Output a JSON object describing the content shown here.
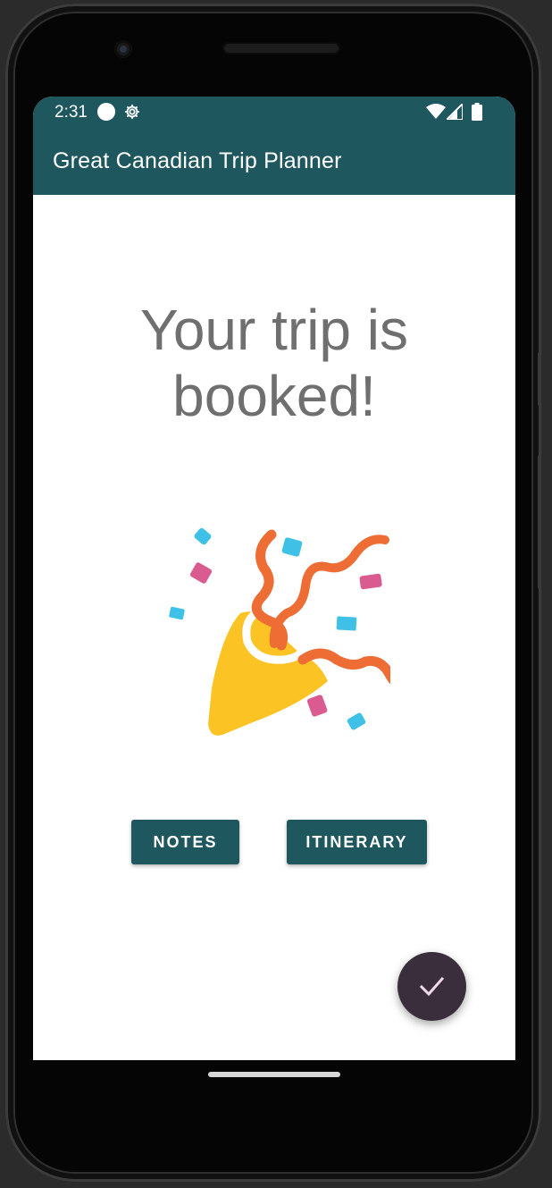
{
  "status_bar": {
    "time": "2:31",
    "icons": [
      "circle-icon",
      "gear-icon",
      "wifi-icon",
      "signal-icon",
      "battery-icon"
    ]
  },
  "app_bar": {
    "title": "Great Canadian Trip Planner"
  },
  "main": {
    "headline_line1": "Your trip is",
    "headline_line2": "booked!",
    "illustration": "party-popper-icon"
  },
  "buttons": {
    "notes_label": "NOTES",
    "itinerary_label": "ITINERARY"
  },
  "fab": {
    "icon": "checkmark-icon"
  },
  "colors": {
    "primary": "#1e575e",
    "fab": "#3b2e3c",
    "headline": "#6f6f6f",
    "confetti_blue": "#3ec0e7",
    "confetti_pink": "#d95b8f",
    "streamer_orange": "#ed6d35",
    "popper_yellow": "#fbc324"
  }
}
